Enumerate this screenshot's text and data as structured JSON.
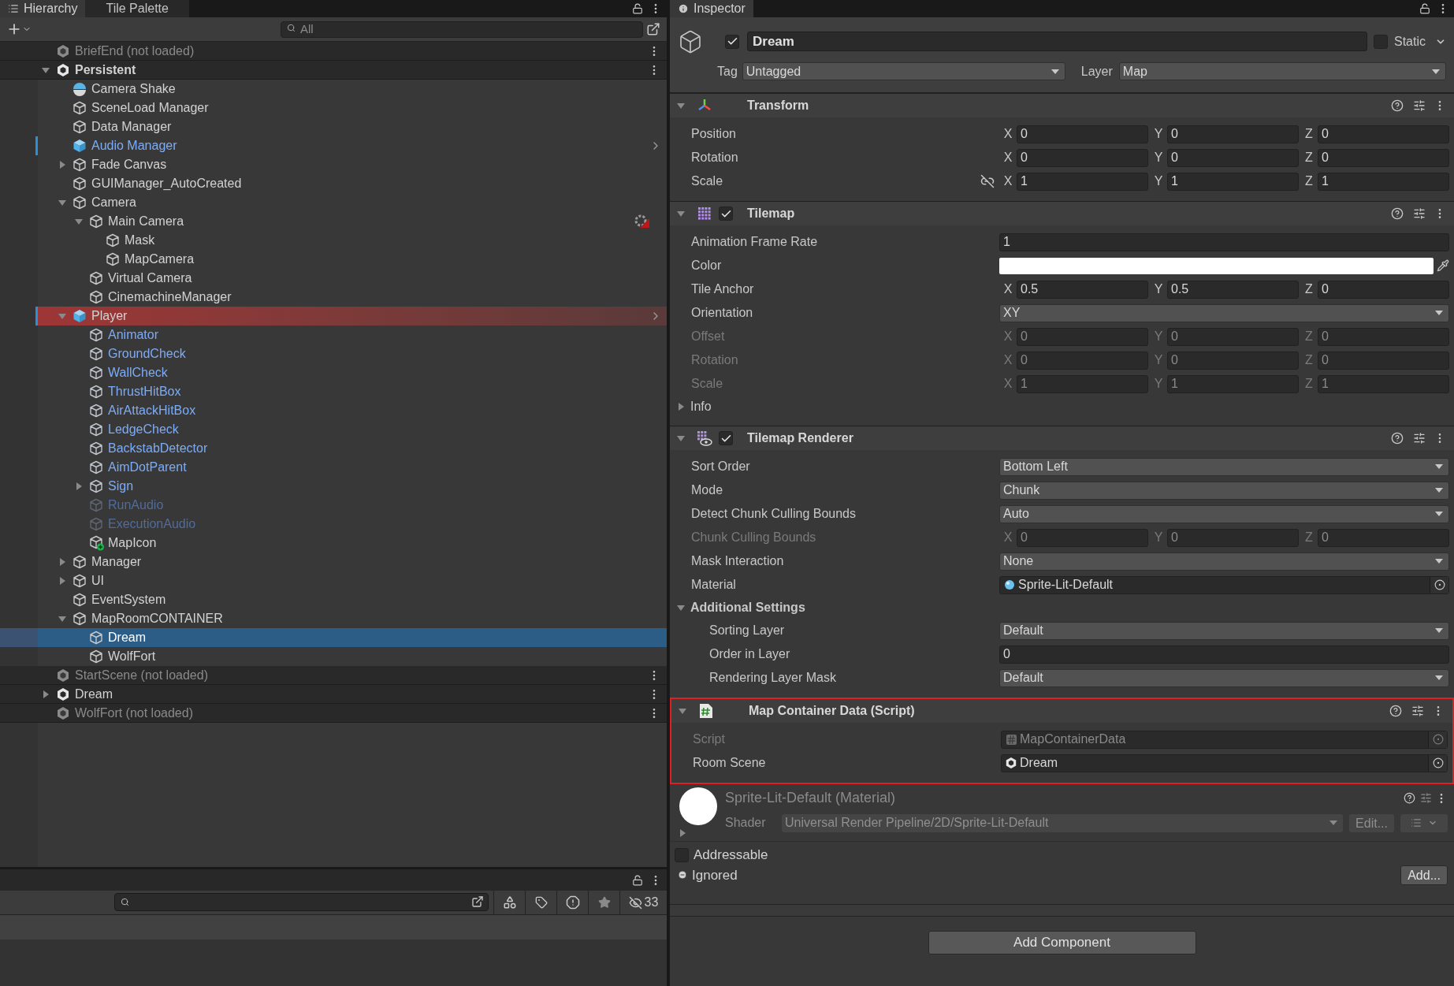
{
  "hierarchy": {
    "tabs": [
      {
        "label": "Hierarchy",
        "selected": true
      },
      {
        "label": "Tile Palette",
        "selected": false
      }
    ],
    "search": {
      "placeholder": "All"
    },
    "items": [
      {
        "name": "BriefEnd (not loaded)",
        "kind": "scene",
        "loaded": false,
        "active": false,
        "selected": false
      },
      {
        "name": "Persistent",
        "kind": "scene",
        "loaded": true,
        "active": true,
        "selected": false,
        "expanded": true,
        "children": [
          {
            "name": "Camera Shake",
            "kind": "effect",
            "active": true,
            "selected": false,
            "highlighted": false,
            "overridden": false
          },
          {
            "name": "SceneLoad Manager",
            "kind": "gameobject",
            "active": true,
            "selected": false,
            "highlighted": false,
            "overridden": false
          },
          {
            "name": "Data Manager",
            "kind": "gameobject",
            "active": true,
            "selected": false,
            "highlighted": false,
            "overridden": false
          },
          {
            "name": "Audio Manager",
            "kind": "prefab_root",
            "active": true,
            "selected": false,
            "highlighted": false,
            "overridden": true
          },
          {
            "name": "Fade Canvas",
            "kind": "gameobject",
            "active": true,
            "selected": false,
            "highlighted": false,
            "overridden": false,
            "expanded": false
          },
          {
            "name": "GUIManager_AutoCreated",
            "kind": "gameobject",
            "active": true,
            "selected": false,
            "highlighted": false,
            "overridden": false
          },
          {
            "name": "Camera",
            "kind": "gameobject",
            "active": true,
            "selected": false,
            "highlighted": false,
            "overridden": false,
            "expanded": true,
            "children": [
              {
                "name": "Main Camera",
                "kind": "gameobject",
                "active": true,
                "selected": false,
                "highlighted": false,
                "overridden": false,
                "badge": {
                  "kind": "gizmo"
                },
                "expanded": true,
                "children": [
                  {
                    "name": "Mask",
                    "kind": "gameobject",
                    "active": true,
                    "selected": false,
                    "highlighted": false,
                    "overridden": false
                  },
                  {
                    "name": "MapCamera",
                    "kind": "gameobject",
                    "active": true,
                    "selected": false,
                    "highlighted": false,
                    "overridden": false
                  }
                ]
              },
              {
                "name": "Virtual Camera",
                "kind": "gameobject",
                "active": true,
                "selected": false,
                "highlighted": false,
                "overridden": false
              },
              {
                "name": "CinemachineManager",
                "kind": "gameobject",
                "active": true,
                "selected": false,
                "highlighted": false,
                "overridden": false
              }
            ]
          },
          {
            "name": "Player",
            "kind": "prefab_root",
            "active": true,
            "selected": false,
            "highlighted": true,
            "overridden": true,
            "expanded": true,
            "children": [
              {
                "name": "Animator",
                "kind": "prefab_child",
                "active": true,
                "selected": false,
                "highlighted": false,
                "overridden": false
              },
              {
                "name": "GroundCheck",
                "kind": "prefab_child",
                "active": true,
                "selected": false,
                "highlighted": false,
                "overridden": false
              },
              {
                "name": "WallCheck",
                "kind": "prefab_child",
                "active": true,
                "selected": false,
                "highlighted": false,
                "overridden": false
              },
              {
                "name": "ThrustHitBox",
                "kind": "prefab_child",
                "active": true,
                "selected": false,
                "highlighted": false,
                "overridden": false
              },
              {
                "name": "AirAttackHitBox",
                "kind": "prefab_child",
                "active": true,
                "selected": false,
                "highlighted": false,
                "overridden": false
              },
              {
                "name": "LedgeCheck",
                "kind": "prefab_child",
                "active": true,
                "selected": false,
                "highlighted": false,
                "overridden": false
              },
              {
                "name": "BackstabDetector",
                "kind": "prefab_child",
                "active": true,
                "selected": false,
                "highlighted": false,
                "overridden": false
              },
              {
                "name": "AimDotParent",
                "kind": "prefab_child",
                "active": true,
                "selected": false,
                "highlighted": false,
                "overridden": false
              },
              {
                "name": "Sign",
                "kind": "prefab_child",
                "active": true,
                "selected": false,
                "highlighted": false,
                "overridden": false,
                "expanded": false
              },
              {
                "name": "RunAudio",
                "kind": "prefab_child",
                "active": false,
                "selected": false,
                "highlighted": false,
                "overridden": false
              },
              {
                "name": "ExecutionAudio",
                "kind": "prefab_child",
                "active": false,
                "selected": false,
                "highlighted": false,
                "overridden": false
              },
              {
                "name": "MapIcon",
                "kind": "added_object",
                "active": true,
                "selected": false,
                "highlighted": false,
                "overridden": false
              }
            ]
          },
          {
            "name": "Manager",
            "kind": "gameobject",
            "active": true,
            "selected": false,
            "highlighted": false,
            "overridden": false,
            "expanded": false
          },
          {
            "name": "UI",
            "kind": "gameobject",
            "active": true,
            "selected": false,
            "highlighted": false,
            "overridden": false,
            "expanded": false
          },
          {
            "name": "EventSystem",
            "kind": "gameobject",
            "active": true,
            "selected": false,
            "highlighted": false,
            "overridden": false
          },
          {
            "name": "MapRoomCONTAINER",
            "kind": "gameobject",
            "active": true,
            "selected": false,
            "highlighted": false,
            "overridden": false,
            "expanded": true,
            "children": [
              {
                "name": "Dream",
                "kind": "gameobject",
                "active": true,
                "selected": true,
                "highlighted": false,
                "overridden": false
              },
              {
                "name": "WolfFort",
                "kind": "gameobject",
                "active": true,
                "selected": false,
                "highlighted": false,
                "overridden": false
              }
            ]
          }
        ]
      },
      {
        "name": "StartScene (not loaded)",
        "kind": "scene",
        "loaded": false,
        "active": false,
        "selected": false
      },
      {
        "name": "Dream",
        "kind": "scene",
        "loaded": true,
        "active": false,
        "selected": false,
        "expanded": false
      },
      {
        "name": "WolfFort (not loaded)",
        "kind": "scene",
        "loaded": false,
        "active": false,
        "selected": false
      }
    ]
  },
  "project": {
    "count": "33"
  },
  "inspector": {
    "tab": {
      "label": "Inspector",
      "selected": true
    },
    "object": {
      "active": true,
      "name": "Dream",
      "static_label": "Static",
      "static": false,
      "tag_label": "Tag",
      "tag": "Untagged",
      "layer_label": "Layer",
      "layer": "Map"
    },
    "components": [
      {
        "kind": "transform",
        "title": "Transform",
        "expanded": true,
        "annotated": false,
        "properties": [
          {
            "kind": "vector3",
            "label": "Position",
            "disabled": false,
            "axes": [
              {
                "axis": "X",
                "value": "0"
              },
              {
                "axis": "Y",
                "value": "0"
              },
              {
                "axis": "Z",
                "value": "0"
              }
            ]
          },
          {
            "kind": "vector3",
            "label": "Rotation",
            "disabled": false,
            "axes": [
              {
                "axis": "X",
                "value": "0"
              },
              {
                "axis": "Y",
                "value": "0"
              },
              {
                "axis": "Z",
                "value": "0"
              }
            ]
          },
          {
            "kind": "vector3",
            "label": "Scale",
            "disabled": false,
            "linked": false,
            "axes": [
              {
                "axis": "X",
                "value": "1"
              },
              {
                "axis": "Y",
                "value": "1"
              },
              {
                "axis": "Z",
                "value": "1"
              }
            ]
          }
        ]
      },
      {
        "kind": "tilemap",
        "title": "Tilemap",
        "enabled": true,
        "expanded": true,
        "annotated": false,
        "properties": [
          {
            "kind": "number",
            "label": "Animation Frame Rate",
            "disabled": false,
            "value": "1"
          },
          {
            "kind": "color",
            "label": "Color",
            "disabled": false,
            "color": "#ffffff"
          },
          {
            "kind": "vector3",
            "label": "Tile Anchor",
            "disabled": false,
            "axes": [
              {
                "axis": "X",
                "value": "0.5"
              },
              {
                "axis": "Y",
                "value": "0.5"
              },
              {
                "axis": "Z",
                "value": "0"
              }
            ]
          },
          {
            "kind": "dropdown",
            "label": "Orientation",
            "disabled": false,
            "value": "XY"
          },
          {
            "kind": "vector3",
            "label": "Offset",
            "disabled": true,
            "axes": [
              {
                "axis": "X",
                "value": "0"
              },
              {
                "axis": "Y",
                "value": "0"
              },
              {
                "axis": "Z",
                "value": "0"
              }
            ]
          },
          {
            "kind": "vector3",
            "label": "Rotation",
            "disabled": true,
            "axes": [
              {
                "axis": "X",
                "value": "0"
              },
              {
                "axis": "Y",
                "value": "0"
              },
              {
                "axis": "Z",
                "value": "0"
              }
            ]
          },
          {
            "kind": "vector3",
            "label": "Scale",
            "disabled": true,
            "axes": [
              {
                "axis": "X",
                "value": "1"
              },
              {
                "axis": "Y",
                "value": "1"
              },
              {
                "axis": "Z",
                "value": "1"
              }
            ]
          },
          {
            "kind": "foldout",
            "label": "Info",
            "disabled": false,
            "expanded": false
          }
        ]
      },
      {
        "kind": "tilemap_renderer",
        "title": "Tilemap Renderer",
        "enabled": true,
        "expanded": true,
        "annotated": false,
        "properties": [
          {
            "kind": "dropdown",
            "label": "Sort Order",
            "disabled": false,
            "value": "Bottom Left"
          },
          {
            "kind": "dropdown",
            "label": "Mode",
            "disabled": false,
            "value": "Chunk"
          },
          {
            "kind": "dropdown",
            "label": "Detect Chunk Culling Bounds",
            "disabled": false,
            "value": "Auto"
          },
          {
            "kind": "vector3",
            "label": "Chunk Culling Bounds",
            "disabled": true,
            "axes": [
              {
                "axis": "X",
                "value": "0"
              },
              {
                "axis": "Y",
                "value": "0"
              },
              {
                "axis": "Z",
                "value": "0"
              }
            ]
          },
          {
            "kind": "dropdown",
            "label": "Mask Interaction",
            "disabled": false,
            "value": "None"
          },
          {
            "kind": "material_object",
            "label": "Material",
            "disabled": false,
            "value": "Sprite-Lit-Default"
          },
          {
            "kind": "foldout",
            "label": "Additional Settings",
            "disabled": false,
            "expanded": true,
            "children": [
              {
                "kind": "dropdown",
                "label": "Sorting Layer",
                "disabled": false,
                "value": "Default"
              },
              {
                "kind": "number",
                "label": "Order in Layer",
                "disabled": false,
                "value": "0"
              },
              {
                "kind": "dropdown",
                "label": "Rendering Layer Mask",
                "disabled": false,
                "value": "Default"
              }
            ]
          }
        ]
      },
      {
        "kind": "script",
        "title": "Map Container Data (Script)",
        "expanded": true,
        "annotated": true,
        "properties": [
          {
            "kind": "script_object",
            "label": "Script",
            "disabled": true,
            "value": "MapContainerData"
          },
          {
            "kind": "scene_object",
            "label": "Room Scene",
            "disabled": false,
            "value": "Dream"
          }
        ]
      }
    ],
    "material": {
      "title": "Sprite-Lit-Default (Material)",
      "expanded": false,
      "shader_label": "Shader",
      "shader": "Universal Render Pipeline/2D/Sprite-Lit-Default",
      "edit_button": "Edit..."
    },
    "addressable": {
      "label": "Addressable",
      "checked": false
    },
    "ignored": {
      "label": "Ignored"
    },
    "add_button": "Add...",
    "add_component": "Add Component"
  }
}
